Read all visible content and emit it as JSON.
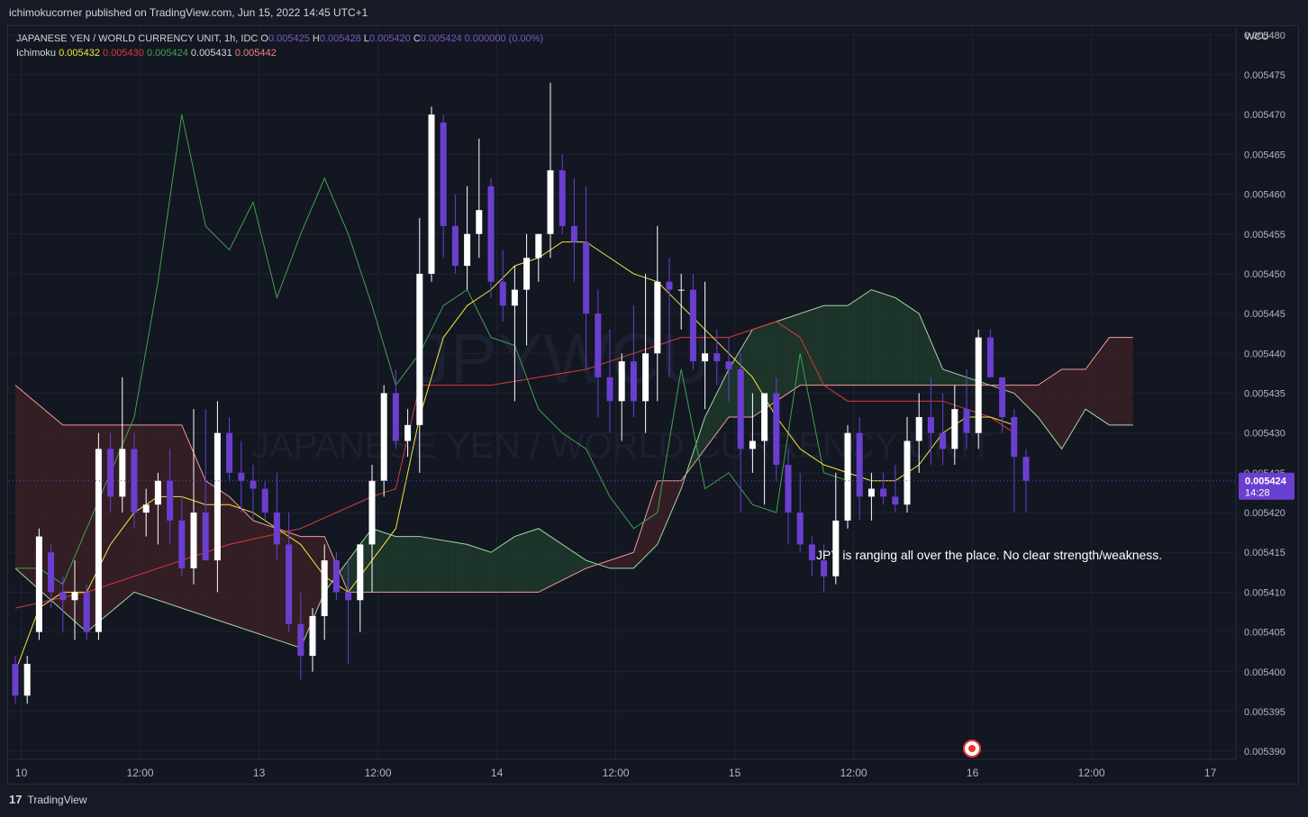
{
  "header": {
    "publisher_line": "ichimokucorner published on TradingView.com, Jun 15, 2022 14:45 UTC+1"
  },
  "footer": {
    "logo_text": "17",
    "brand": "TradingView"
  },
  "chart_data": {
    "type": "candlestick",
    "title": "JAPANESE YEN / WORLD CURRENCY UNIT, 1h, IDC",
    "watermark_main": "JPYWCU, 1h",
    "watermark_sub": "JAPANESE YEN / WORLD CURRENCY UNIT",
    "ohlc_legend": {
      "o_label": "O",
      "o": "0.005425",
      "h_label": "H",
      "h": "0.005428",
      "l_label": "L",
      "l": "0.005420",
      "c_label": "C",
      "c": "0.005424",
      "change": "0.000000 (0.00%)"
    },
    "indicator": {
      "name": "Ichimoku",
      "values": [
        "0.005432",
        "0.005430",
        "0.005424",
        "0.005431",
        "0.005442"
      ],
      "colors": [
        "#f5e33b",
        "#d93a3a",
        "#3fa34d",
        "#d1d4dc",
        "#f08080"
      ]
    },
    "currency_label": "WCU",
    "y_ticks": [
      "0.005390",
      "0.005395",
      "0.005400",
      "0.005405",
      "0.005410",
      "0.005415",
      "0.005420",
      "0.005425",
      "0.005430",
      "0.005435",
      "0.005440",
      "0.005445",
      "0.005450",
      "0.005455",
      "0.005460",
      "0.005465",
      "0.005470",
      "0.005475",
      "0.005480"
    ],
    "ylim": [
      0.005389,
      0.005481
    ],
    "x_ticks": [
      "10",
      "12:00",
      "13",
      "12:00",
      "14",
      "12:00",
      "15",
      "12:00",
      "16",
      "12:00",
      "17"
    ],
    "x_tick_index": [
      0.5,
      10.5,
      20.5,
      30.5,
      40.5,
      50.5,
      60.5,
      70.5,
      80.5,
      90.5,
      100.5
    ],
    "last_price_label": {
      "price": "0.005424",
      "countdown": "14:28"
    },
    "last_price": 0.005424,
    "annotation": "JPY is ranging all over the place. No clear strength/weakness.",
    "colors": {
      "up": "#ffffff",
      "down": "#6a3fd0",
      "tenkan": "#f5e33b",
      "kijun": "#d93a3a",
      "chikou": "#3fa34d",
      "span_a": "#a5d6a7",
      "span_b": "#ef9a9a",
      "bull_cloud": "#1e3a2a",
      "bear_cloud": "#3a2026",
      "price_label_bg": "#6a3fd0",
      "price_line": "#6a3fd0"
    },
    "candles": [
      [
        0.005401,
        0.005402,
        0.005396,
        0.005397
      ],
      [
        0.005397,
        0.005402,
        0.005396,
        0.005401
      ],
      [
        0.005405,
        0.005418,
        0.005404,
        0.005417
      ],
      [
        0.005415,
        0.005416,
        0.005408,
        0.00541
      ],
      [
        0.00541,
        0.005412,
        0.005405,
        0.005409
      ],
      [
        0.005409,
        0.005414,
        0.005404,
        0.00541
      ],
      [
        0.00541,
        0.005411,
        0.005404,
        0.005405
      ],
      [
        0.005405,
        0.00543,
        0.005404,
        0.005428
      ],
      [
        0.005428,
        0.00543,
        0.00542,
        0.005422
      ],
      [
        0.005422,
        0.005437,
        0.00542,
        0.005428
      ],
      [
        0.005428,
        0.00543,
        0.005418,
        0.00542
      ],
      [
        0.00542,
        0.005423,
        0.005417,
        0.005421
      ],
      [
        0.005421,
        0.005425,
        0.005416,
        0.005424
      ],
      [
        0.005424,
        0.005428,
        0.005416,
        0.005419
      ],
      [
        0.005419,
        0.005422,
        0.005412,
        0.005413
      ],
      [
        0.005413,
        0.005433,
        0.005411,
        0.00542
      ],
      [
        0.00542,
        0.005433,
        0.005416,
        0.005414
      ],
      [
        0.005414,
        0.005434,
        0.00541,
        0.00543
      ],
      [
        0.00543,
        0.005432,
        0.005424,
        0.005425
      ],
      [
        0.005425,
        0.005429,
        0.00542,
        0.005424
      ],
      [
        0.005424,
        0.005426,
        0.005419,
        0.005423
      ],
      [
        0.005423,
        0.005424,
        0.005419,
        0.00542
      ],
      [
        0.00542,
        0.005425,
        0.005414,
        0.005416
      ],
      [
        0.005416,
        0.00542,
        0.005405,
        0.005406
      ],
      [
        0.005406,
        0.00541,
        0.005399,
        0.005402
      ],
      [
        0.005402,
        0.005408,
        0.0054,
        0.005407
      ],
      [
        0.005407,
        0.005416,
        0.005404,
        0.005414
      ],
      [
        0.005414,
        0.005415,
        0.005409,
        0.00541
      ],
      [
        0.00541,
        0.005414,
        0.005401,
        0.005409
      ],
      [
        0.005409,
        0.005415,
        0.005405,
        0.005416
      ],
      [
        0.005416,
        0.005426,
        0.00541,
        0.005424
      ],
      [
        0.005424,
        0.005436,
        0.005422,
        0.005435
      ],
      [
        0.005435,
        0.005438,
        0.005428,
        0.005429
      ],
      [
        0.005429,
        0.005433,
        0.005427,
        0.005431
      ],
      [
        0.005431,
        0.005457,
        0.005425,
        0.00545
      ],
      [
        0.00545,
        0.005471,
        0.005449,
        0.00547
      ],
      [
        0.005469,
        0.00547,
        0.005452,
        0.005456
      ],
      [
        0.005456,
        0.00546,
        0.00545,
        0.005451
      ],
      [
        0.005451,
        0.005461,
        0.005448,
        0.005455
      ],
      [
        0.005455,
        0.005467,
        0.005452,
        0.005458
      ],
      [
        0.005461,
        0.005462,
        0.005447,
        0.005449
      ],
      [
        0.005449,
        0.005453,
        0.005444,
        0.005446
      ],
      [
        0.005446,
        0.005451,
        0.005434,
        0.005448
      ],
      [
        0.005448,
        0.005455,
        0.005441,
        0.005452
      ],
      [
        0.005452,
        0.005455,
        0.005449,
        0.005455
      ],
      [
        0.005455,
        0.005474,
        0.005452,
        0.005463
      ],
      [
        0.005463,
        0.005465,
        0.005455,
        0.005456
      ],
      [
        0.005456,
        0.005462,
        0.005449,
        0.005454
      ],
      [
        0.005454,
        0.005461,
        0.005438,
        0.005445
      ],
      [
        0.005445,
        0.005448,
        0.005432,
        0.005437
      ],
      [
        0.005437,
        0.005443,
        0.00543,
        0.005434
      ],
      [
        0.005434,
        0.00544,
        0.005429,
        0.005439
      ],
      [
        0.005439,
        0.005446,
        0.005432,
        0.005434
      ],
      [
        0.005434,
        0.00545,
        0.00543,
        0.00544
      ],
      [
        0.00544,
        0.005456,
        0.005434,
        0.005449
      ],
      [
        0.005449,
        0.005452,
        0.005437,
        0.005448
      ],
      [
        0.005448,
        0.00545,
        0.005443,
        0.005448
      ],
      [
        0.005448,
        0.00545,
        0.005438,
        0.005439
      ],
      [
        0.005439,
        0.005449,
        0.005433,
        0.00544
      ],
      [
        0.00544,
        0.005443,
        0.005436,
        0.005439
      ],
      [
        0.005439,
        0.005442,
        0.005434,
        0.005438
      ],
      [
        0.005438,
        0.00544,
        0.00542,
        0.005428
      ],
      [
        0.005428,
        0.005435,
        0.005425,
        0.005429
      ],
      [
        0.005429,
        0.005434,
        0.005421,
        0.005435
      ],
      [
        0.005435,
        0.005437,
        0.005424,
        0.005426
      ],
      [
        0.005426,
        0.005428,
        0.005416,
        0.00542
      ],
      [
        0.00542,
        0.005425,
        0.005415,
        0.005416
      ],
      [
        0.005416,
        0.005417,
        0.005412,
        0.005414
      ],
      [
        0.005414,
        0.005416,
        0.00541,
        0.005412
      ],
      [
        0.005412,
        0.005425,
        0.005411,
        0.005419
      ],
      [
        0.005419,
        0.005431,
        0.005418,
        0.00543
      ],
      [
        0.00543,
        0.005432,
        0.005419,
        0.005422
      ],
      [
        0.005422,
        0.005425,
        0.005419,
        0.005423
      ],
      [
        0.005423,
        0.005425,
        0.005421,
        0.005422
      ],
      [
        0.005422,
        0.005426,
        0.00542,
        0.005421
      ],
      [
        0.005421,
        0.005432,
        0.00542,
        0.005429
      ],
      [
        0.005429,
        0.005435,
        0.005425,
        0.005432
      ],
      [
        0.005432,
        0.005437,
        0.005426,
        0.00543
      ],
      [
        0.00543,
        0.005435,
        0.005426,
        0.005428
      ],
      [
        0.005428,
        0.005436,
        0.005426,
        0.005433
      ],
      [
        0.005433,
        0.005438,
        0.005428,
        0.00543
      ],
      [
        0.00543,
        0.005443,
        0.005428,
        0.005442
      ],
      [
        0.005442,
        0.005443,
        0.005438,
        0.005437
      ],
      [
        0.005437,
        0.005437,
        0.00543,
        0.005432
      ],
      [
        0.005432,
        0.005433,
        0.00542,
        0.005427
      ],
      [
        0.005427,
        0.005428,
        0.00542,
        0.005424
      ]
    ],
    "tenkan": [
      [
        0,
        0.0054
      ],
      [
        2,
        0.005408
      ],
      [
        4,
        0.00541
      ],
      [
        6,
        0.00541
      ],
      [
        8,
        0.005416
      ],
      [
        10,
        0.00542
      ],
      [
        12,
        0.005422
      ],
      [
        14,
        0.005422
      ],
      [
        16,
        0.005421
      ],
      [
        18,
        0.005421
      ],
      [
        20,
        0.00542
      ],
      [
        22,
        0.005418
      ],
      [
        24,
        0.005416
      ],
      [
        26,
        0.005412
      ],
      [
        28,
        0.00541
      ],
      [
        30,
        0.005414
      ],
      [
        32,
        0.005418
      ],
      [
        34,
        0.005432
      ],
      [
        36,
        0.005442
      ],
      [
        38,
        0.005446
      ],
      [
        40,
        0.005448
      ],
      [
        42,
        0.005451
      ],
      [
        44,
        0.005452
      ],
      [
        46,
        0.005454
      ],
      [
        48,
        0.005454
      ],
      [
        50,
        0.005452
      ],
      [
        52,
        0.00545
      ],
      [
        54,
        0.005449
      ],
      [
        56,
        0.005446
      ],
      [
        58,
        0.005443
      ],
      [
        60,
        0.00544
      ],
      [
        62,
        0.005437
      ],
      [
        64,
        0.005432
      ],
      [
        66,
        0.005428
      ],
      [
        68,
        0.005426
      ],
      [
        70,
        0.005425
      ],
      [
        72,
        0.005424
      ],
      [
        74,
        0.005424
      ],
      [
        76,
        0.005426
      ],
      [
        78,
        0.00543
      ],
      [
        80,
        0.005432
      ],
      [
        82,
        0.005432
      ],
      [
        84,
        0.005431
      ]
    ],
    "kijun": [
      [
        0,
        0.005408
      ],
      [
        6,
        0.00541
      ],
      [
        12,
        0.005413
      ],
      [
        18,
        0.005416
      ],
      [
        24,
        0.005418
      ],
      [
        30,
        0.005422
      ],
      [
        32,
        0.005423
      ],
      [
        34,
        0.005436
      ],
      [
        40,
        0.005436
      ],
      [
        44,
        0.005437
      ],
      [
        48,
        0.005438
      ],
      [
        52,
        0.00544
      ],
      [
        56,
        0.005442
      ],
      [
        60,
        0.005442
      ],
      [
        64,
        0.005444
      ],
      [
        66,
        0.005442
      ],
      [
        68,
        0.005436
      ],
      [
        70,
        0.005434
      ],
      [
        74,
        0.005434
      ],
      [
        78,
        0.005434
      ],
      [
        82,
        0.005432
      ],
      [
        84,
        0.00543
      ]
    ],
    "chikou": [
      [
        0,
        0.005413
      ],
      [
        2,
        0.005413
      ],
      [
        4,
        0.005411
      ],
      [
        6,
        0.005418
      ],
      [
        8,
        0.005425
      ],
      [
        10,
        0.005432
      ],
      [
        12,
        0.005449
      ],
      [
        14,
        0.00547
      ],
      [
        16,
        0.005456
      ],
      [
        18,
        0.005453
      ],
      [
        20,
        0.005459
      ],
      [
        22,
        0.005447
      ],
      [
        24,
        0.005455
      ],
      [
        26,
        0.005462
      ],
      [
        28,
        0.005455
      ],
      [
        30,
        0.005446
      ],
      [
        32,
        0.005436
      ],
      [
        34,
        0.00544
      ],
      [
        36,
        0.005446
      ],
      [
        38,
        0.005448
      ],
      [
        40,
        0.005442
      ],
      [
        42,
        0.005441
      ],
      [
        44,
        0.005433
      ],
      [
        46,
        0.00543
      ],
      [
        48,
        0.005428
      ],
      [
        50,
        0.005422
      ],
      [
        52,
        0.005418
      ],
      [
        54,
        0.00542
      ],
      [
        56,
        0.005438
      ],
      [
        58,
        0.005423
      ],
      [
        60,
        0.005425
      ],
      [
        62,
        0.005421
      ],
      [
        64,
        0.00542
      ],
      [
        66,
        0.00544
      ],
      [
        68,
        0.005425
      ],
      [
        70,
        0.005424
      ]
    ],
    "span_a": [
      [
        0,
        0.005413
      ],
      [
        6,
        0.005405
      ],
      [
        10,
        0.00541
      ],
      [
        14,
        0.005408
      ],
      [
        18,
        0.005406
      ],
      [
        22,
        0.005404
      ],
      [
        24,
        0.005403
      ],
      [
        26,
        0.00541
      ],
      [
        30,
        0.005418
      ],
      [
        32,
        0.005417
      ],
      [
        34,
        0.005417
      ],
      [
        38,
        0.005416
      ],
      [
        40,
        0.005415
      ],
      [
        42,
        0.005417
      ],
      [
        44,
        0.005418
      ],
      [
        46,
        0.005416
      ],
      [
        48,
        0.005414
      ],
      [
        50,
        0.005413
      ],
      [
        52,
        0.005413
      ],
      [
        54,
        0.005416
      ],
      [
        56,
        0.005423
      ],
      [
        58,
        0.005432
      ],
      [
        60,
        0.005438
      ],
      [
        62,
        0.005443
      ],
      [
        64,
        0.005444
      ],
      [
        66,
        0.005445
      ],
      [
        68,
        0.005446
      ],
      [
        70,
        0.005446
      ],
      [
        72,
        0.005448
      ],
      [
        74,
        0.005447
      ],
      [
        76,
        0.005445
      ],
      [
        78,
        0.005438
      ],
      [
        80,
        0.005437
      ],
      [
        82,
        0.005436
      ],
      [
        84,
        0.005435
      ],
      [
        86,
        0.005432
      ],
      [
        88,
        0.005428
      ],
      [
        90,
        0.005433
      ],
      [
        92,
        0.005431
      ],
      [
        94,
        0.005431
      ]
    ],
    "span_b": [
      [
        0,
        0.005436
      ],
      [
        4,
        0.005431
      ],
      [
        8,
        0.005431
      ],
      [
        12,
        0.005431
      ],
      [
        14,
        0.005431
      ],
      [
        16,
        0.005424
      ],
      [
        18,
        0.005422
      ],
      [
        20,
        0.005419
      ],
      [
        22,
        0.005418
      ],
      [
        24,
        0.005417
      ],
      [
        26,
        0.005417
      ],
      [
        28,
        0.00541
      ],
      [
        34,
        0.00541
      ],
      [
        40,
        0.00541
      ],
      [
        44,
        0.00541
      ],
      [
        48,
        0.005413
      ],
      [
        52,
        0.005415
      ],
      [
        54,
        0.005424
      ],
      [
        56,
        0.005424
      ],
      [
        60,
        0.005432
      ],
      [
        62,
        0.005432
      ],
      [
        64,
        0.005434
      ],
      [
        66,
        0.005436
      ],
      [
        70,
        0.005436
      ],
      [
        74,
        0.005436
      ],
      [
        76,
        0.005436
      ],
      [
        78,
        0.005436
      ],
      [
        80,
        0.005436
      ],
      [
        84,
        0.005436
      ],
      [
        86,
        0.005436
      ],
      [
        88,
        0.005438
      ],
      [
        90,
        0.005438
      ],
      [
        92,
        0.005442
      ],
      [
        94,
        0.005442
      ]
    ]
  }
}
